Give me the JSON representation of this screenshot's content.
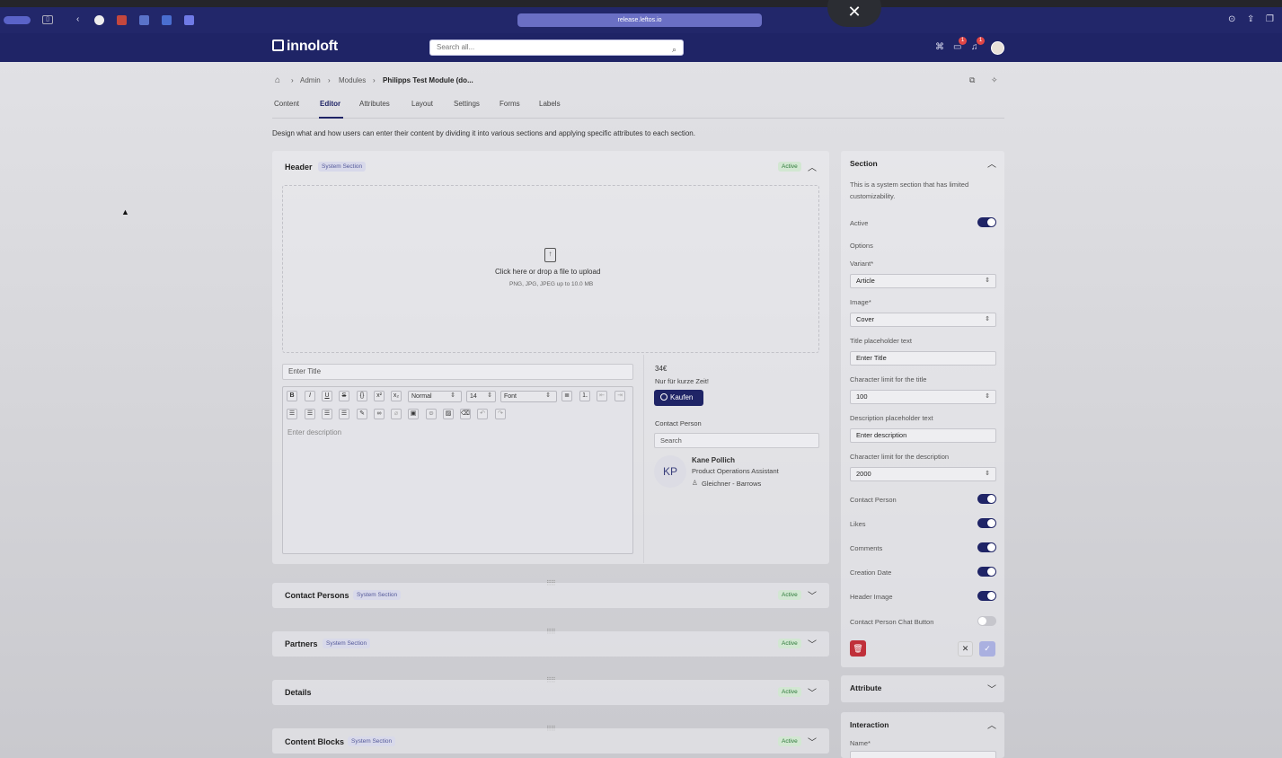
{
  "browser": {
    "url": "release.leftos.io"
  },
  "app": {
    "logo": "innoloft",
    "search_placeholder": "Search all...",
    "badge_messages": "1",
    "badge_notifications": "1"
  },
  "breadcrumb": {
    "items": [
      "Admin",
      "Modules",
      "Philipps Test Module (do..."
    ]
  },
  "tabs": [
    "Content",
    "Editor",
    "Attributes",
    "Layout",
    "Settings",
    "Forms",
    "Labels"
  ],
  "page": {
    "description": "Design what and how users can enter their content by dividing it into various sections and applying specific attributes to each section."
  },
  "header_section": {
    "title": "Header",
    "badge": "System Section",
    "status": "Active",
    "upload_text": "Click here or drop a file to upload",
    "upload_hint": "PNG, JPG, JPEG up to 10.0 MB",
    "title_placeholder": "Enter Title",
    "desc_placeholder": "Enter description",
    "toolbar": {
      "style": "Normal",
      "size": "14",
      "font": "Font"
    },
    "price": "34€",
    "price_note": "Nur für kurze Zeit!",
    "buy_label": "Kaufen",
    "contact_label": "Contact Person",
    "contact_search": "Search",
    "contact": {
      "initials": "KP",
      "name": "Kane Pollich",
      "role": "Product Operations Assistant",
      "org": "Gleichner - Barrows"
    }
  },
  "sections": [
    {
      "title": "Contact Persons",
      "badge": "System Section",
      "status": "Active"
    },
    {
      "title": "Partners",
      "badge": "System Section",
      "status": "Active"
    },
    {
      "title": "Details",
      "badge": "",
      "status": "Active"
    },
    {
      "title": "Content Blocks",
      "badge": "System Section",
      "status": "Active"
    }
  ],
  "panel": {
    "title": "Section",
    "note": "This is a system section that has limited customizability.",
    "active_label": "Active",
    "options_label": "Options",
    "variant_label": "Variant*",
    "variant_value": "Article",
    "image_label": "Image*",
    "image_value": "Cover",
    "title_ph_label": "Title placeholder text",
    "title_ph_value": "Enter Title",
    "title_limit_label": "Character limit for the title",
    "title_limit_value": "100",
    "desc_ph_label": "Description placeholder text",
    "desc_ph_value": "Enter description",
    "desc_limit_label": "Character limit for the description",
    "desc_limit_value": "2000",
    "toggles": [
      {
        "label": "Contact Person",
        "on": true
      },
      {
        "label": "Likes",
        "on": true
      },
      {
        "label": "Comments",
        "on": true
      },
      {
        "label": "Creation Date",
        "on": true
      },
      {
        "label": "Header Image",
        "on": true
      },
      {
        "label": "Contact Person Chat Button",
        "on": false
      }
    ],
    "attribute_title": "Attribute",
    "interaction_title": "Interaction",
    "name_label": "Name*"
  },
  "colors": {
    "brand": "#1f2466",
    "danger": "#c0303a"
  }
}
